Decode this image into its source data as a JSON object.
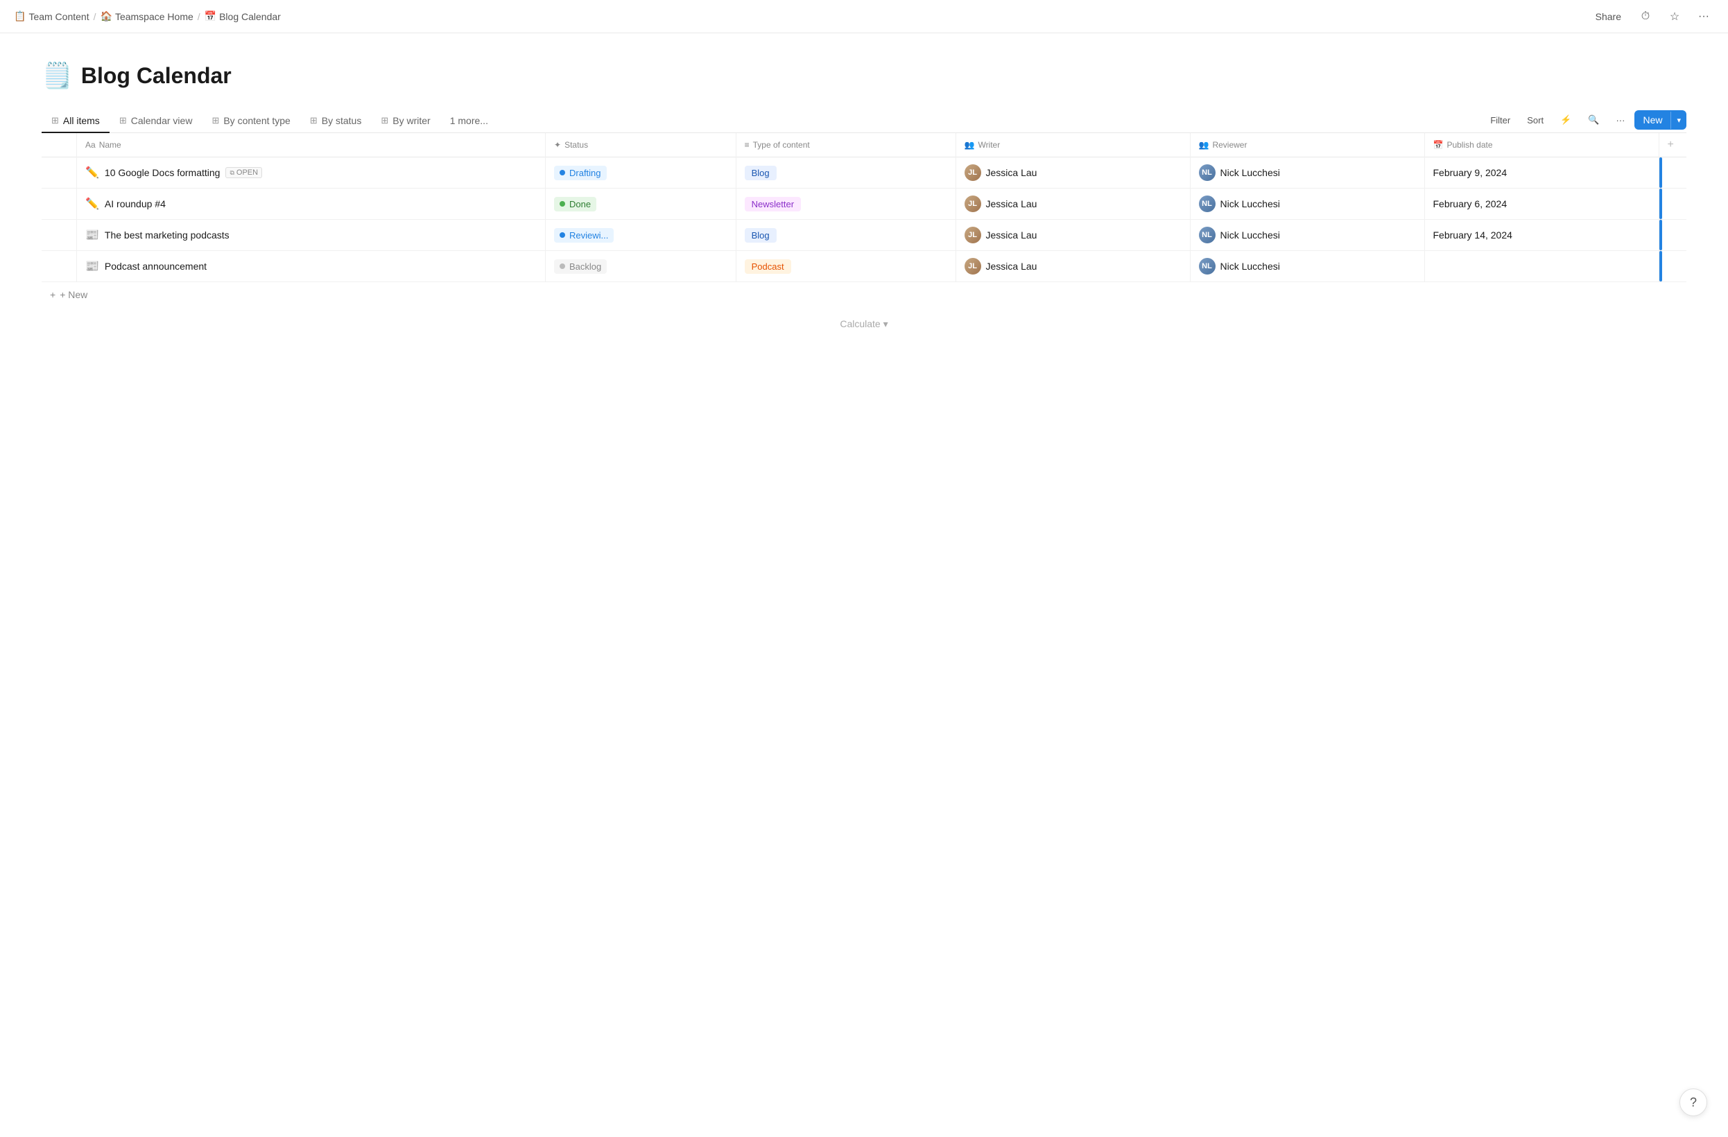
{
  "topbar": {
    "breadcrumbs": [
      {
        "icon": "📋",
        "label": "Team Content"
      },
      {
        "icon": "🏠",
        "label": "Teamspace Home"
      },
      {
        "icon": "📅",
        "label": "Blog Calendar"
      }
    ],
    "share_label": "Share",
    "history_icon": "⏱",
    "star_icon": "☆",
    "more_icon": "···"
  },
  "page": {
    "icon": "🗒️",
    "title": "Blog Calendar"
  },
  "tabs": [
    {
      "id": "all-items",
      "icon": "⊞",
      "label": "All items",
      "active": true
    },
    {
      "id": "calendar-view",
      "icon": "⊞",
      "label": "Calendar view",
      "active": false
    },
    {
      "id": "by-content-type",
      "icon": "⊞",
      "label": "By content type",
      "active": false
    },
    {
      "id": "by-status",
      "icon": "⊞",
      "label": "By status",
      "active": false
    },
    {
      "id": "by-writer",
      "icon": "⊞",
      "label": "By writer",
      "active": false
    },
    {
      "id": "more",
      "label": "1 more...",
      "active": false
    }
  ],
  "actions": {
    "filter": "Filter",
    "sort": "Sort",
    "lightning_icon": "⚡",
    "search_icon": "🔍",
    "more_icon": "···",
    "new_label": "New",
    "chevron": "▾"
  },
  "columns": [
    {
      "id": "name",
      "icon": "Aa",
      "label": "Name"
    },
    {
      "id": "status",
      "icon": "✦",
      "label": "Status"
    },
    {
      "id": "type",
      "icon": "≡",
      "label": "Type of content"
    },
    {
      "id": "writer",
      "icon": "👥",
      "label": "Writer"
    },
    {
      "id": "reviewer",
      "icon": "👥",
      "label": "Reviewer"
    },
    {
      "id": "publish_date",
      "icon": "📅",
      "label": "Publish date"
    }
  ],
  "rows": [
    {
      "id": 1,
      "name_icon": "✏️",
      "name": "10 Google Docs formatting",
      "has_open_badge": true,
      "open_badge_label": "OPEN",
      "status": "Drafting",
      "status_class": "status-drafting",
      "type": "Blog",
      "type_class": "tag-blog",
      "writer": "Jessica Lau",
      "reviewer": "Nick Lucchesi",
      "publish_date": "February 9, 2024",
      "has_right_indicator": true
    },
    {
      "id": 2,
      "name_icon": "✏️",
      "name": "AI roundup #4",
      "has_open_badge": false,
      "status": "Done",
      "status_class": "status-done",
      "type": "Newsletter",
      "type_class": "tag-newsletter",
      "writer": "Jessica Lau",
      "reviewer": "Nick Lucchesi",
      "publish_date": "February 6, 2024",
      "has_right_indicator": true
    },
    {
      "id": 3,
      "name_icon": "📰",
      "name": "The best marketing podcasts",
      "has_open_badge": false,
      "status": "Reviewi...",
      "status_class": "status-reviewing",
      "type": "Blog",
      "type_class": "tag-blog",
      "writer": "Jessica Lau",
      "reviewer": "Nick Lucchesi",
      "publish_date": "February 14, 2024",
      "has_right_indicator": true
    },
    {
      "id": 4,
      "name_icon": "📰",
      "name": "Podcast announcement",
      "has_open_badge": false,
      "status": "Backlog",
      "status_class": "status-backlog",
      "type": "Podcast",
      "type_class": "tag-podcast",
      "writer": "Jessica Lau",
      "reviewer": "Nick Lucchesi",
      "publish_date": "",
      "has_right_indicator": true
    }
  ],
  "new_row_label": "+ New",
  "calculate_label": "Calculate",
  "calculate_chevron": "▾",
  "help_icon": "?"
}
